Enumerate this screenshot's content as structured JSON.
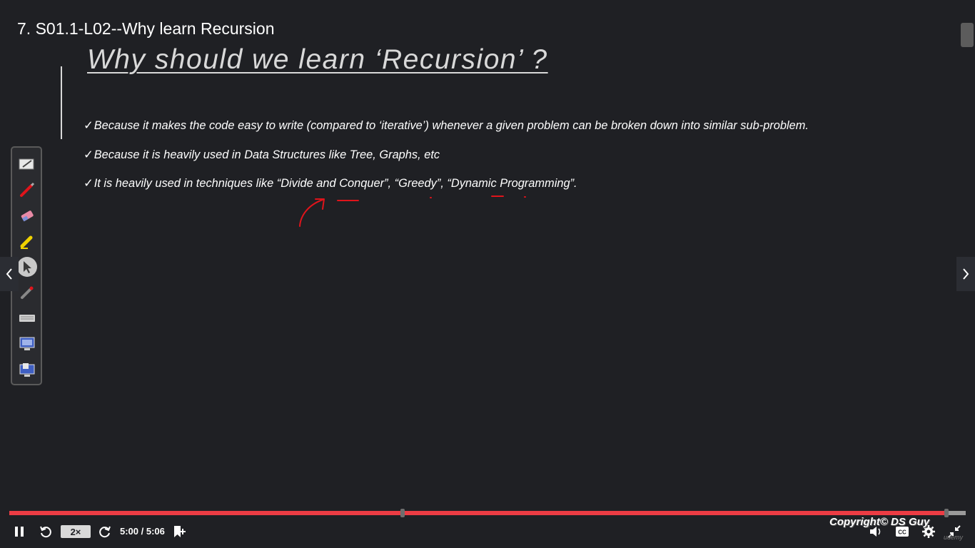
{
  "lecture_title": "7. S01.1-L02--Why learn Recursion",
  "slide": {
    "heading": "Why should we learn ‘Recursion’ ?",
    "bullets": [
      {
        "check": "✓",
        "text": "Because it makes the code easy to write (compared to ‘iterative’) whenever a given problem can be broken down into similar sub-problem."
      },
      {
        "check": "✓",
        "text": "Because it is heavily used in Data Structures like Tree, Graphs, etc"
      },
      {
        "check": "✓",
        "text": "It is heavily used in techniques like “Divide and Conquer”, “Greedy”, “Dynamic Programming”."
      }
    ]
  },
  "tool_palette": {
    "tools": [
      {
        "name": "whiteboard",
        "icon": "whiteboard-icon"
      },
      {
        "name": "pen",
        "icon": "pen-icon"
      },
      {
        "name": "eraser",
        "icon": "eraser-icon"
      },
      {
        "name": "highlighter",
        "icon": "highlighter-icon"
      },
      {
        "name": "pointer",
        "icon": "pointer-icon",
        "active": true
      },
      {
        "name": "laser",
        "icon": "laser-pointer-icon"
      },
      {
        "name": "keyboard",
        "icon": "keyboard-icon"
      },
      {
        "name": "screen",
        "icon": "screen-icon"
      },
      {
        "name": "screens",
        "icon": "multi-screen-icon"
      }
    ]
  },
  "player": {
    "speed": "2×",
    "time": "5:00 / 5:06",
    "progress_fraction": 0.98,
    "copyright": "Copyright© DS Guy",
    "watermark": "udemy"
  },
  "colors": {
    "background": "#1f2024",
    "progress": "#ec3c44",
    "ink": "#e0141b"
  }
}
